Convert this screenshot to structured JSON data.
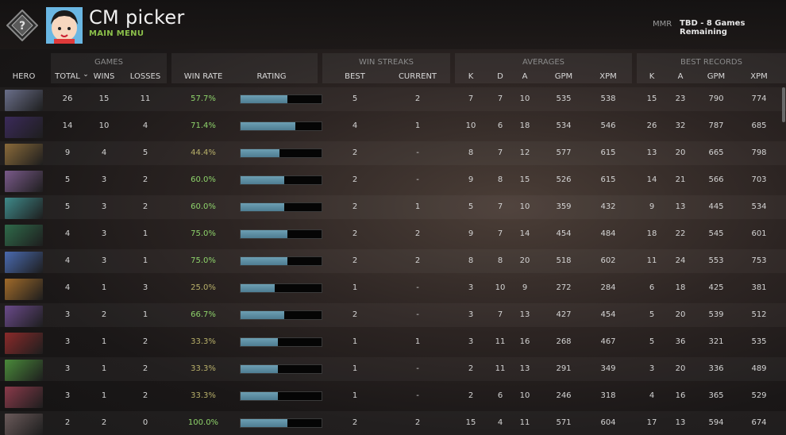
{
  "header": {
    "title": "CM picker",
    "subtitle": "MAIN MENU",
    "mmr_label": "MMR",
    "mmr_value": "TBD - 8 Games Remaining",
    "rank_icon": "rank-question-icon",
    "avatar_icon": "avatar-icon"
  },
  "table": {
    "groups": {
      "games": "GAMES",
      "win_streaks": "WIN STREAKS",
      "averages": "AVERAGES",
      "best_records": "BEST RECORDS"
    },
    "columns": {
      "hero": "HERO",
      "total": "TOTAL",
      "sort_arrow": "⌄",
      "wins": "WINS",
      "losses": "LOSSES",
      "win_rate": "WIN RATE",
      "rating": "RATING",
      "best": "BEST",
      "current": "CURRENT",
      "k": "K",
      "d": "D",
      "a": "A",
      "gpm": "GPM",
      "xpm": "XPM",
      "best_k": "K",
      "best_a": "A",
      "best_gpm": "GPM",
      "best_xpm": "XPM"
    },
    "rows": [
      {
        "portrait": "#6a6f8a",
        "total": "26",
        "wins": "15",
        "losses": "11",
        "win_rate": "57.7%",
        "rating": 0.58,
        "best": "5",
        "current": "2",
        "k": "7",
        "d": "7",
        "a": "10",
        "gpm": "535",
        "xpm": "538",
        "best_k": "15",
        "best_a": "23",
        "best_gpm": "790",
        "best_xpm": "774"
      },
      {
        "portrait": "#3b2a5a",
        "total": "14",
        "wins": "10",
        "losses": "4",
        "win_rate": "71.4%",
        "rating": 0.68,
        "best": "4",
        "current": "1",
        "k": "10",
        "d": "6",
        "a": "18",
        "gpm": "534",
        "xpm": "546",
        "best_k": "26",
        "best_a": "32",
        "best_gpm": "787",
        "best_xpm": "685"
      },
      {
        "portrait": "#8a6a3a",
        "total": "9",
        "wins": "4",
        "losses": "5",
        "win_rate": "44.4%",
        "rating": 0.48,
        "best": "2",
        "current": "-",
        "k": "8",
        "d": "7",
        "a": "12",
        "gpm": "577",
        "xpm": "615",
        "best_k": "13",
        "best_a": "20",
        "best_gpm": "665",
        "best_xpm": "798"
      },
      {
        "portrait": "#7a5a8a",
        "total": "5",
        "wins": "3",
        "losses": "2",
        "win_rate": "60.0%",
        "rating": 0.54,
        "best": "2",
        "current": "-",
        "k": "9",
        "d": "8",
        "a": "15",
        "gpm": "526",
        "xpm": "615",
        "best_k": "14",
        "best_a": "21",
        "best_gpm": "566",
        "best_xpm": "703"
      },
      {
        "portrait": "#3f8a8a",
        "total": "5",
        "wins": "3",
        "losses": "2",
        "win_rate": "60.0%",
        "rating": 0.54,
        "best": "2",
        "current": "1",
        "k": "5",
        "d": "7",
        "a": "10",
        "gpm": "359",
        "xpm": "432",
        "best_k": "9",
        "best_a": "13",
        "best_gpm": "445",
        "best_xpm": "534"
      },
      {
        "portrait": "#2f6a4a",
        "total": "4",
        "wins": "3",
        "losses": "1",
        "win_rate": "75.0%",
        "rating": 0.58,
        "best": "2",
        "current": "2",
        "k": "9",
        "d": "7",
        "a": "14",
        "gpm": "454",
        "xpm": "484",
        "best_k": "18",
        "best_a": "22",
        "best_gpm": "545",
        "best_xpm": "601"
      },
      {
        "portrait": "#4a6ab0",
        "total": "4",
        "wins": "3",
        "losses": "1",
        "win_rate": "75.0%",
        "rating": 0.58,
        "best": "2",
        "current": "2",
        "k": "8",
        "d": "8",
        "a": "20",
        "gpm": "518",
        "xpm": "602",
        "best_k": "11",
        "best_a": "24",
        "best_gpm": "553",
        "best_xpm": "753"
      },
      {
        "portrait": "#a06a2a",
        "total": "4",
        "wins": "1",
        "losses": "3",
        "win_rate": "25.0%",
        "rating": 0.42,
        "best": "1",
        "current": "-",
        "k": "3",
        "d": "10",
        "a": "9",
        "gpm": "272",
        "xpm": "284",
        "best_k": "6",
        "best_a": "18",
        "best_gpm": "425",
        "best_xpm": "381"
      },
      {
        "portrait": "#6a4a8a",
        "total": "3",
        "wins": "2",
        "losses": "1",
        "win_rate": "66.7%",
        "rating": 0.54,
        "best": "2",
        "current": "-",
        "k": "3",
        "d": "7",
        "a": "13",
        "gpm": "427",
        "xpm": "454",
        "best_k": "5",
        "best_a": "20",
        "best_gpm": "539",
        "best_xpm": "512"
      },
      {
        "portrait": "#8a2a2a",
        "total": "3",
        "wins": "1",
        "losses": "2",
        "win_rate": "33.3%",
        "rating": 0.46,
        "best": "1",
        "current": "1",
        "k": "3",
        "d": "11",
        "a": "16",
        "gpm": "268",
        "xpm": "467",
        "best_k": "5",
        "best_a": "36",
        "best_gpm": "321",
        "best_xpm": "535"
      },
      {
        "portrait": "#4a8a3a",
        "total": "3",
        "wins": "1",
        "losses": "2",
        "win_rate": "33.3%",
        "rating": 0.46,
        "best": "1",
        "current": "-",
        "k": "2",
        "d": "11",
        "a": "13",
        "gpm": "291",
        "xpm": "349",
        "best_k": "3",
        "best_a": "20",
        "best_gpm": "336",
        "best_xpm": "489"
      },
      {
        "portrait": "#8a3a4a",
        "total": "3",
        "wins": "1",
        "losses": "2",
        "win_rate": "33.3%",
        "rating": 0.46,
        "best": "1",
        "current": "-",
        "k": "2",
        "d": "6",
        "a": "10",
        "gpm": "246",
        "xpm": "318",
        "best_k": "4",
        "best_a": "16",
        "best_gpm": "365",
        "best_xpm": "529"
      },
      {
        "portrait": "#6a5a5a",
        "total": "2",
        "wins": "2",
        "losses": "0",
        "win_rate": "100.0%",
        "rating": 0.58,
        "best": "2",
        "current": "2",
        "k": "15",
        "d": "4",
        "a": "11",
        "gpm": "571",
        "xpm": "604",
        "best_k": "17",
        "best_a": "13",
        "best_gpm": "594",
        "best_xpm": "674"
      }
    ]
  }
}
